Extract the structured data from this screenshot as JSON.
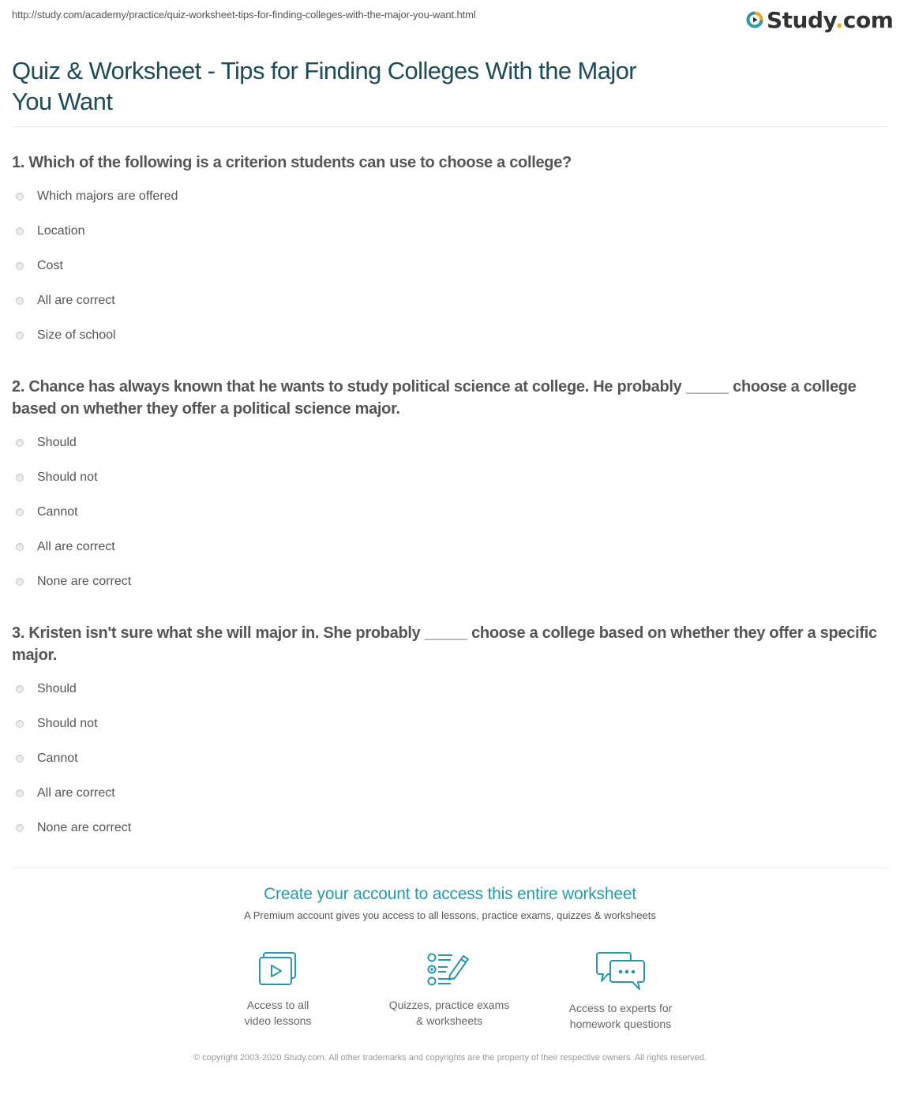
{
  "header": {
    "url": "http://study.com/academy/practice/quiz-worksheet-tips-for-finding-colleges-with-the-major-you-want.html",
    "logo_text": "Study",
    "logo_dot": ".",
    "logo_suffix": "com",
    "brand_colors": {
      "teal": "#2a98a8",
      "orange": "#f5a623",
      "dark": "#333333"
    }
  },
  "page": {
    "title": "Quiz & Worksheet - Tips for Finding Colleges With the Major You Want"
  },
  "questions": [
    {
      "text": "1. Which of the following is a criterion students can use to choose a college?",
      "answers": [
        "Which majors are offered",
        "Location",
        "Cost",
        "All are correct",
        "Size of school"
      ]
    },
    {
      "text": "2. Chance has always known that he wants to study political science at college. He probably _____ choose a college based on whether they offer a political science major.",
      "answers": [
        "Should",
        "Should not",
        "Cannot",
        "All are correct",
        "None are correct"
      ]
    },
    {
      "text": "3. Kristen isn't sure what she will major in. She probably _____ choose a college based on whether they offer a specific major.",
      "answers": [
        "Should",
        "Should not",
        "Cannot",
        "All are correct",
        "None are correct"
      ]
    }
  ],
  "cta": {
    "title": "Create your account to access this entire worksheet",
    "subtitle": "A Premium account gives you access to all lessons, practice exams, quizzes & worksheets",
    "features": [
      {
        "icon": "video-lessons-icon",
        "label": "Access to all\nvideo lessons"
      },
      {
        "icon": "quiz-checklist-icon",
        "label": "Quizzes, practice exams\n& worksheets"
      },
      {
        "icon": "chat-bubbles-icon",
        "label": "Access to experts for\nhomework questions"
      }
    ]
  },
  "footer": {
    "copyright": "© copyright 2003-2020 Study.com. All other trademarks and copyrights are the property of their respective owners. All rights reserved."
  }
}
